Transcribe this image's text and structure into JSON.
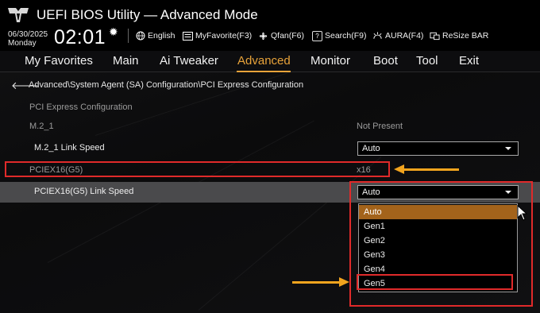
{
  "header": {
    "title": "UEFI BIOS Utility — Advanced Mode",
    "date": "06/30/2025",
    "day": "Monday",
    "time": "02:01",
    "toolbar": [
      {
        "icon": "globe-icon",
        "label": "English"
      },
      {
        "icon": "myfavorite-icon",
        "label": "MyFavorite(F3)"
      },
      {
        "icon": "fan-icon",
        "label": "Qfan(F6)"
      },
      {
        "icon": "help-search-icon",
        "label": "Search(F9)"
      },
      {
        "icon": "aura-icon",
        "label": "AURA(F4)"
      },
      {
        "icon": "resize-bar-icon",
        "label": "ReSize BAR"
      }
    ]
  },
  "menu": {
    "items": [
      "My Favorites",
      "Main",
      "Ai Tweaker",
      "Advanced",
      "Monitor",
      "Boot",
      "Tool",
      "Exit"
    ],
    "active": "Advanced"
  },
  "breadcrumb": "Advanced\\System Agent (SA) Configuration\\PCI Express Configuration",
  "section_title": "PCI Express Configuration",
  "settings": {
    "m2_1_label": "M.2_1",
    "m2_1_status": "Not Present",
    "m2_1_speed_label": "M.2_1 Link Speed",
    "m2_1_speed_value": "Auto",
    "pciex16_label": "PCIEX16(G5)",
    "pciex16_value": "x16",
    "pciex16_speed_label": "PCIEX16(G5) Link Speed",
    "pciex16_speed_value": "Auto"
  },
  "dropdown": {
    "options": [
      "Auto",
      "Gen1",
      "Gen2",
      "Gen3",
      "Gen4",
      "Gen5"
    ],
    "highlighted": "Auto"
  },
  "colors": {
    "accent": "#e8a33a",
    "annotation_red": "#e02a2a",
    "annotation_arrow": "#f2a41e",
    "selected_option": "#a3631b"
  }
}
